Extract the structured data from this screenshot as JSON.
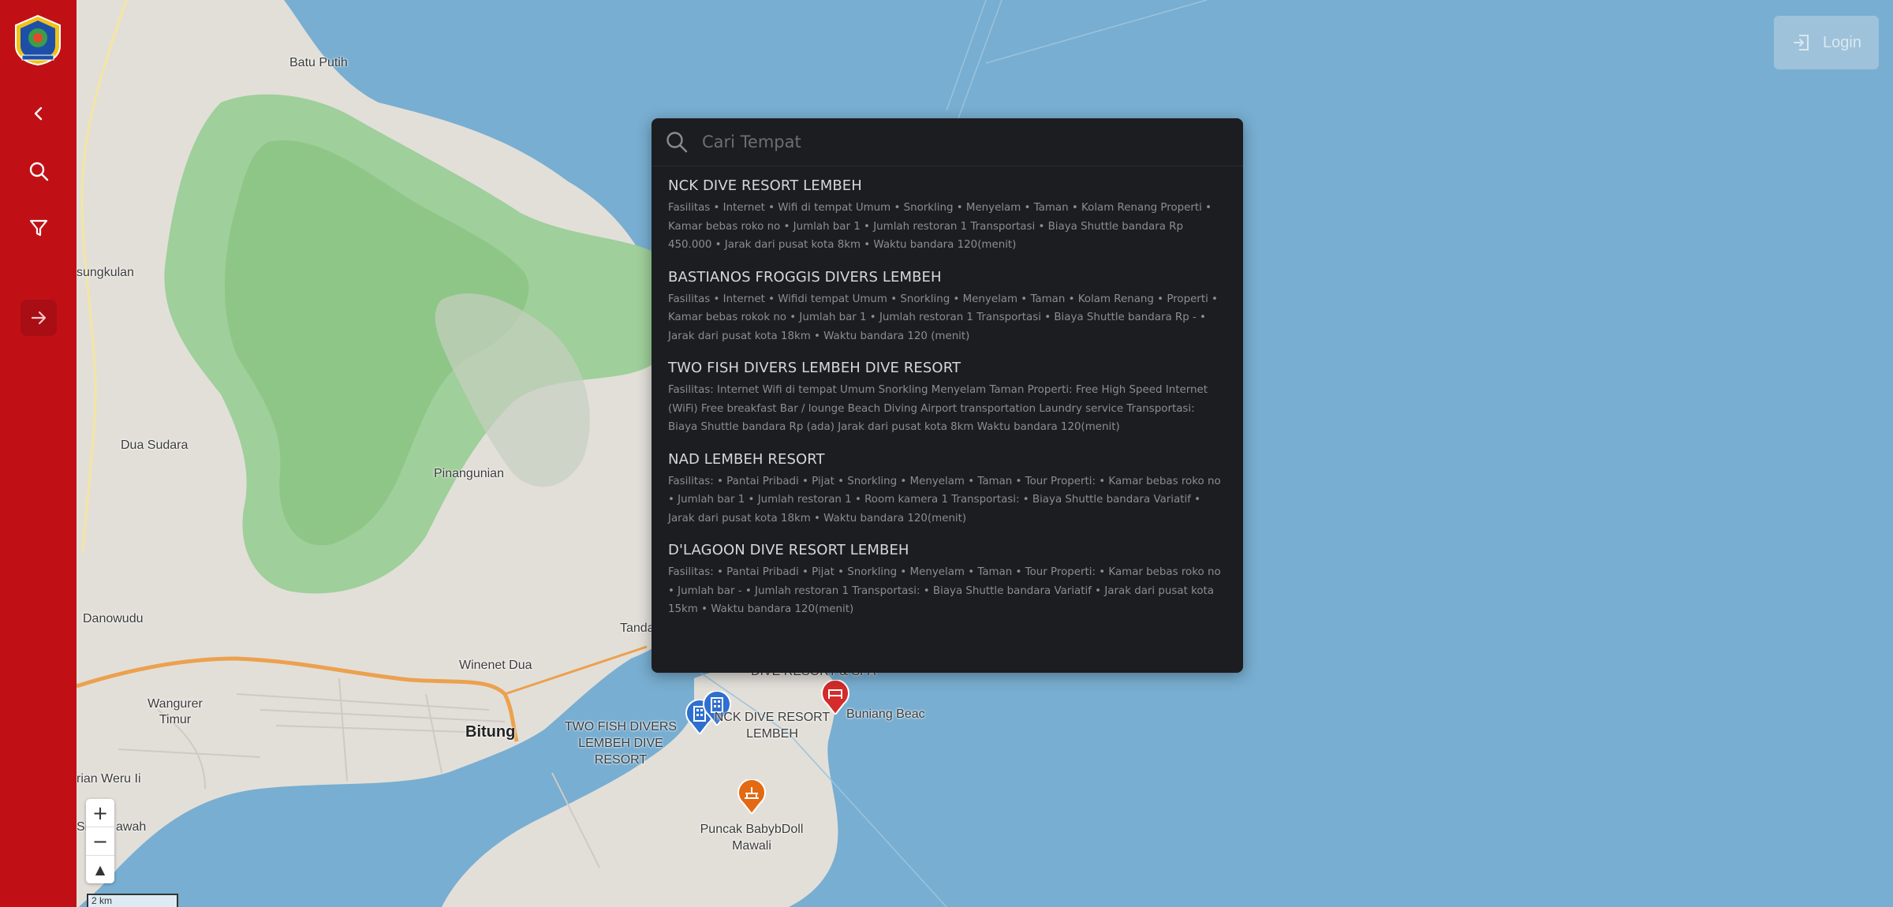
{
  "app": {
    "login_label": "Login"
  },
  "sidebar": {
    "items": [
      {
        "name": "back",
        "icon": "chevron-left-icon"
      },
      {
        "name": "search",
        "icon": "search-icon"
      },
      {
        "name": "filter",
        "icon": "filter-icon"
      },
      {
        "name": "expand",
        "icon": "arrow-right-icon"
      }
    ],
    "color": "#c01016"
  },
  "search": {
    "placeholder": "Cari Tempat",
    "value": "",
    "results": [
      {
        "title": "NCK DIVE RESORT LEMBEH",
        "description": "Fasilitas • Internet • Wifi di tempat Umum • Snorkling • Menyelam • Taman • Kolam Renang Properti • Kamar bebas roko no • Jumlah bar 1 • Jumlah restoran 1 Transportasi • Biaya Shuttle bandara Rp 450.000 • Jarak dari pusat kota 8km • Waktu bandara 120(menit)"
      },
      {
        "title": "BASTIANOS FROGGIS DIVERS LEMBEH",
        "description": "Fasilitas • Internet • Wifidi tempat Umum • Snorkling • Menyelam • Taman • Kolam Renang • Properti • Kamar bebas rokok no • Jumlah bar 1 • Jumlah restoran 1 Transportasi • Biaya Shuttle bandara Rp - • Jarak dari pusat kota 18km • Waktu bandara 120 (menit)"
      },
      {
        "title": "TWO FISH DIVERS LEMBEH DIVE RESORT",
        "description": "Fasilitas: Internet Wifi di tempat Umum Snorkling Menyelam Taman Properti: Free High Speed Internet (WiFi) Free breakfast Bar / lounge Beach Diving Airport transportation Laundry service Transportasi: Biaya Shuttle bandara Rp (ada) Jarak dari pusat kota 8km Waktu bandara 120(menit)"
      },
      {
        "title": "NAD LEMBEH RESORT",
        "description": "Fasilitas: • Pantai Pribadi • Pijat • Snorkling • Menyelam • Taman • Tour Properti: • Kamar bebas roko no • Jumlah bar 1 • Jumlah restoran 1 • Room kamera 1 Transportasi: • Biaya Shuttle bandara Variatif • Jarak dari pusat kota 18km • Waktu bandara 120(menit)"
      },
      {
        "title": "D'LAGOON DIVE RESORT LEMBEH",
        "description": "Fasilitas: • Pantai Pribadi • Pijat • Snorkling • Menyelam • Taman • Tour Properti: • Kamar bebas roko no • Jumlah bar - • Jumlah restoran 1 Transportasi: • Biaya Shuttle bandara Variatif • Jarak dari pusat kota 15km • Waktu bandara 120(menit)"
      }
    ]
  },
  "map": {
    "labels": [
      {
        "text": "Batu Putih",
        "type": "place"
      },
      {
        "text": "sungkulan",
        "type": "place"
      },
      {
        "text": "Dua Sudara",
        "type": "place"
      },
      {
        "text": "Pinangunian",
        "type": "place"
      },
      {
        "text": "Danowudu",
        "type": "place"
      },
      {
        "text": "Tanda",
        "type": "place"
      },
      {
        "text": "Winenet Dua",
        "type": "place"
      },
      {
        "text": "Wangurer Timur",
        "type": "place"
      },
      {
        "text": "Bitung",
        "type": "city"
      },
      {
        "text": "rian Weru Ii",
        "type": "place"
      },
      {
        "text": "Si",
        "type": "place"
      },
      {
        "text": "awah",
        "type": "place"
      },
      {
        "text": "Buniang Beac",
        "type": "place"
      }
    ],
    "markers": [
      {
        "label": "TWO FISH DIVERS LEMBEH DIVE RESORT",
        "icon": "hotel-icon",
        "color": "#2f6fd0"
      },
      {
        "label": "NCK DIVE RESORT LEMBEH",
        "icon": "hotel-icon",
        "color": "#2f6fd0"
      },
      {
        "label": "DIVE RESORT & SPA",
        "icon": "hotel-icon",
        "color": "#d42b2b"
      },
      {
        "label": "Puncak BabybDoll Mawali",
        "icon": "viewpoint-icon",
        "color": "#e36a12"
      }
    ],
    "zoom_in_label": "+",
    "zoom_out_label": "−",
    "compass_label": "▲",
    "scale_label": "2 km"
  }
}
